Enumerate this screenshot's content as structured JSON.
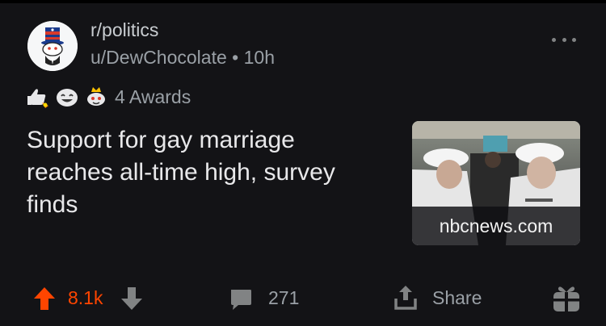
{
  "post": {
    "subreddit": "r/politics",
    "author": "u/DewChocolate",
    "separator": "•",
    "age": "10h",
    "awards_label": "4 Awards",
    "award_icons": [
      "thumbs-up-rocket-award-icon",
      "laughing-face-award-icon",
      "crowned-snoo-award-icon"
    ],
    "title": "Support for gay marriage reaches all-time high, survey finds",
    "link_domain": "nbcnews.com",
    "score": "8.1k",
    "comments": "271",
    "share_label": "Share"
  },
  "colors": {
    "background": "#131316",
    "upvote": "#ff4500",
    "meta_text": "#9aa0a6",
    "title_text": "#e8e8ea"
  },
  "icons": {
    "avatar": "uncle-sam-snoo-avatar-icon",
    "more": "more-options-icon",
    "upvote": "upvote-arrow-icon",
    "downvote": "downvote-arrow-icon",
    "comment": "comment-bubble-icon",
    "share": "share-icon",
    "gift": "gift-award-icon"
  }
}
